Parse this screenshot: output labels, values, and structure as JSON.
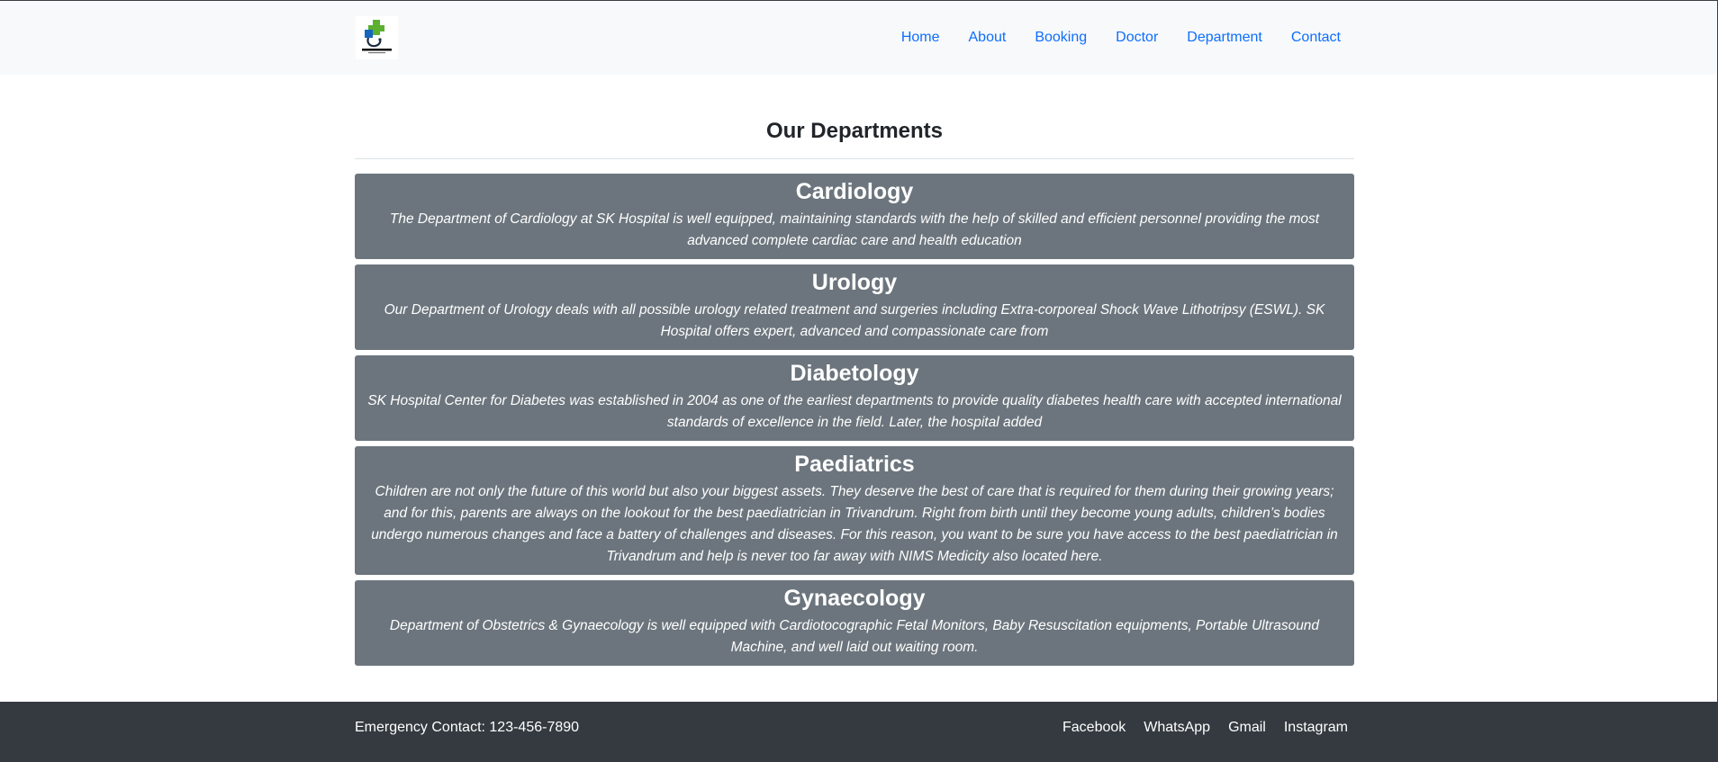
{
  "navbar": {
    "logo_text": "HEALTH CARE",
    "links": [
      "Home",
      "About",
      "Booking",
      "Doctor",
      "Department",
      "Contact"
    ]
  },
  "main": {
    "title": "Our Departments",
    "departments": [
      {
        "name": "Cardiology",
        "description": "The Department of Cardiology at SK Hospital is well equipped, maintaining standards with the help of skilled and efficient personnel providing the most advanced complete cardiac care and health education"
      },
      {
        "name": "Urology",
        "description": "Our Department of Urology deals with all possible urology related treatment and surgeries including Extra-corporeal Shock Wave Lithotripsy (ESWL). SK Hospital offers expert, advanced and compassionate care from"
      },
      {
        "name": "Diabetology",
        "description": "SK Hospital Center for Diabetes was established in 2004 as one of the earliest departments to provide quality diabetes health care with accepted international standards of excellence in the field. Later, the hospital added"
      },
      {
        "name": "Paediatrics",
        "description": "Children are not only the future of this world but also your biggest assets. They deserve the best of care that is required for them during their growing years; and for this, parents are always on the lookout for the best paediatrician in Trivandrum. Right from birth until they become young adults, children’s bodies undergo numerous changes and face a battery of challenges and diseases. For this reason, you want to be sure you have access to the best paediatrician in Trivandrum and help is never too far away with NIMS Medicity also located here."
      },
      {
        "name": "Gynaecology",
        "description": "Department of Obstetrics & Gynaecology is well equipped with Cardiotocographic Fetal Monitors, Baby Resuscitation equipments, Portable Ultrasound Machine, and well laid out waiting room."
      }
    ]
  },
  "footer": {
    "emergency": "Emergency Contact: 123-456-7890",
    "social": [
      "Facebook",
      "WhatsApp",
      "Gmail",
      "Instagram"
    ]
  },
  "colors": {
    "navbar_bg": "#f8f9fa",
    "link": "#0d6efd",
    "card_bg": "#6c757d",
    "footer_bg": "#343a40",
    "logo_cross_green": "#5bb030",
    "logo_cross_blue": "#1565c0"
  },
  "icons": {
    "logo": "health-care-cross-logo"
  }
}
